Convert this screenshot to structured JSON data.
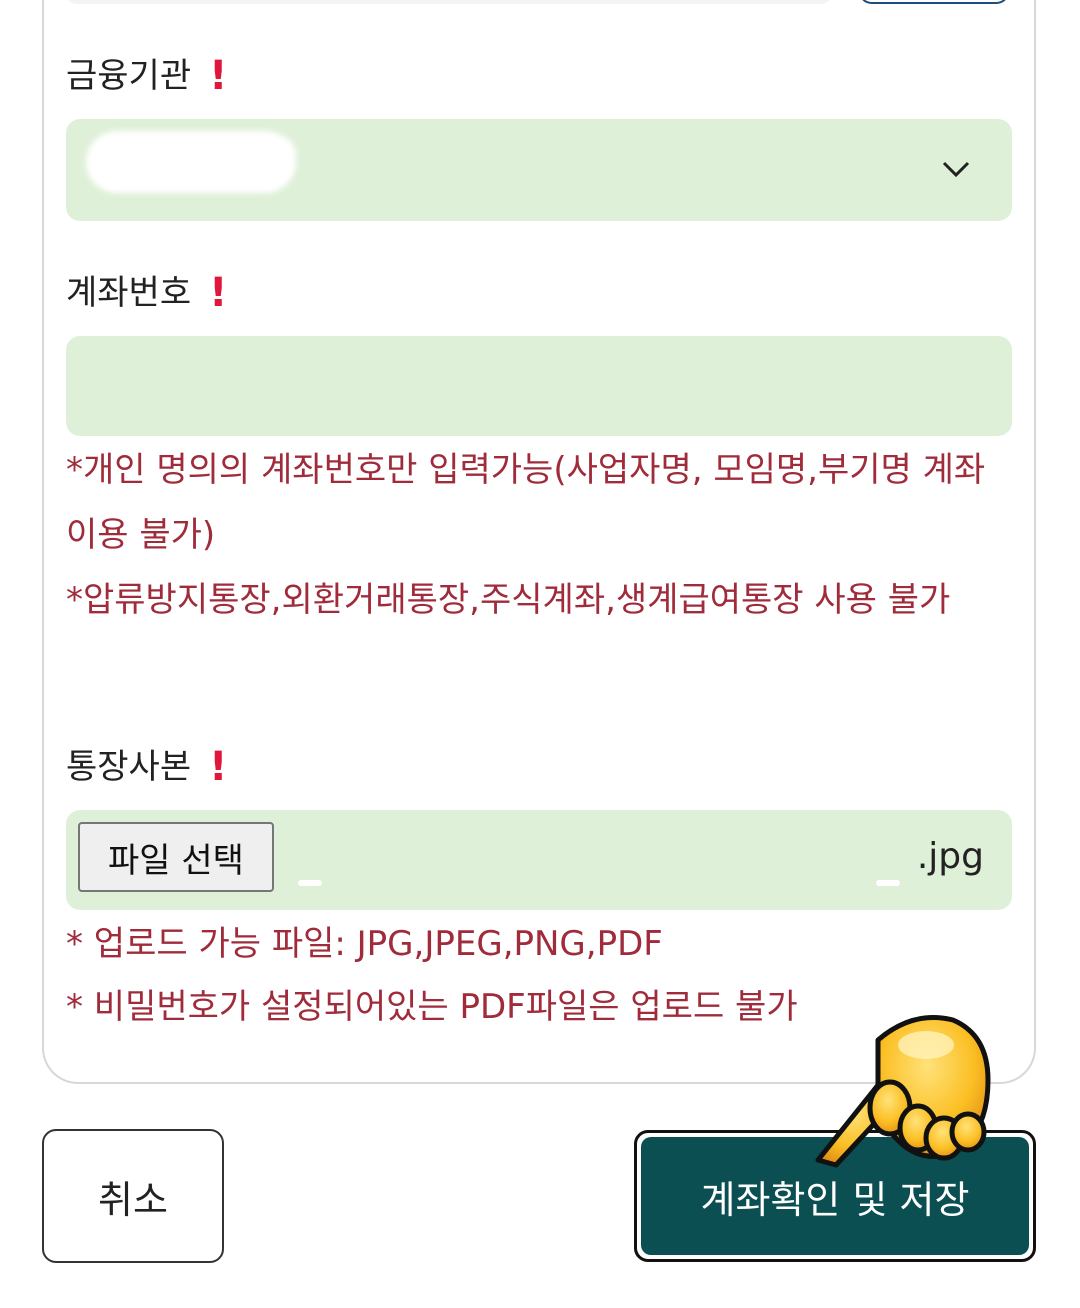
{
  "form": {
    "bank": {
      "label": "금융기관",
      "required_mark": "!",
      "selected_value_masked": true
    },
    "account": {
      "label": "계좌번호",
      "required_mark": "!",
      "value": "",
      "notice_1": "*개인 명의의 계좌번호만 입력가능(사업자명, 모임명,부기명 계좌 이용 불가)",
      "notice_2": "*압류방지통장,외환거래통장,주식계좌,생계급여통장 사용 불가"
    },
    "bankbook": {
      "label": "통장사본",
      "required_mark": "!",
      "file_button": "파일 선택",
      "file_name": ".jpg",
      "notice_1": "* 업로드 가능 파일: JPG,JPEG,PNG,PDF",
      "notice_2": "* 비밀번호가 설정되어있는 PDF파일은 업로드 불가"
    }
  },
  "actions": {
    "cancel": "취소",
    "save": "계좌확인 및 저장"
  },
  "colors": {
    "field_bg": "#dff0d8",
    "required": "#e0173a",
    "notice": "#a02b3a",
    "primary": "#0b4f52"
  },
  "icons": {
    "select_arrow": "chevron-down-icon",
    "pointer_overlay": "pointing-hand-emoji"
  }
}
